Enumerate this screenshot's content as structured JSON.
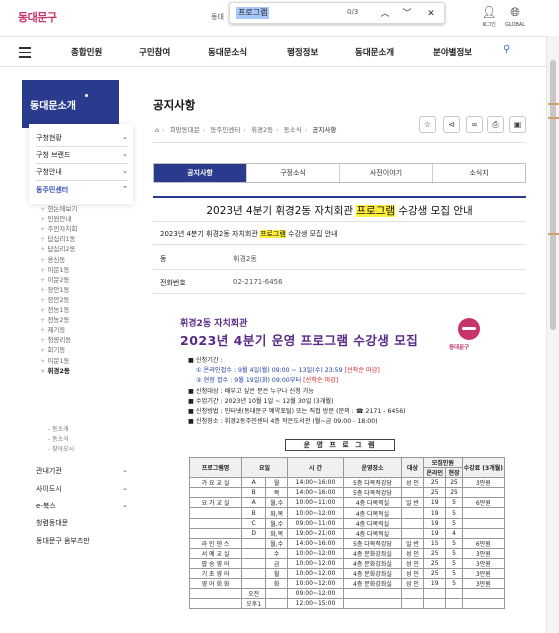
{
  "header": {
    "logo": "동대문구",
    "top_crumb": "동대",
    "login_label": "로그인",
    "global_label": "GLOBAL"
  },
  "find": {
    "query": "프로그램",
    "count": "0/3",
    "prev_icon": "chevron-up-icon",
    "next_icon": "chevron-down-icon",
    "close_icon": "close-icon"
  },
  "nav": {
    "items": [
      "종합민원",
      "구민참여",
      "동대문소식",
      "행정정보",
      "동대문소개",
      "분야별정보"
    ]
  },
  "sidebar": {
    "title": "동대문소개",
    "l1": [
      "구청현황",
      "구청 브랜드",
      "구청안내",
      "동주민센터"
    ],
    "dongs": [
      "전농1동주민센터",
      "한논에보기",
      "민원안내",
      "주민자치회",
      "답십리1동",
      "답십리2동",
      "용신동",
      "이문1동",
      "이문2동",
      "장안1동",
      "장안2동",
      "전농1동",
      "전농2동",
      "제기동",
      "청량리동",
      "회기동",
      "이문1동",
      "휘경2동"
    ],
    "dong_list": [
      "현논에보기",
      "민원안내",
      "주민자치회",
      "답십리1동",
      "답십리2동",
      "용신동",
      "이문1동",
      "이문2동",
      "장안1동",
      "장안2동",
      "전농1동",
      "전농2동",
      "제기동",
      "청량리동",
      "회기동",
      "이문1동",
      "휘경2동"
    ],
    "sub": [
      "동소개",
      "동소식",
      "찾아오시"
    ],
    "bottom": [
      "관내기관",
      "사이도시",
      "e-북스",
      "청렴동대문",
      "동대문구 옴부즈만"
    ]
  },
  "page": {
    "title": "공지사항",
    "crumbs": [
      "희망동대문",
      "동주민센터",
      "휘경2동",
      "동소식",
      "공지사항"
    ],
    "tabs": [
      "공지사항",
      "구정소식",
      "사진이야기",
      "소식지"
    ],
    "post_title_pre": "2023년 4분기 휘경2동 자치회관",
    "post_title_hl": "프로그램",
    "post_title_post": "수강생 모집 안내",
    "post_sub_pre": "2023년 4분기 휘경2동 자치회관",
    "post_sub_hl": "프로그램",
    "post_sub_post": "수강생 모집 안내",
    "dept_key": "동",
    "dept_val": "휘경2동",
    "phone_key": "전화번호",
    "phone_val": "02-2171-6456"
  },
  "poster": {
    "sub": "휘경2동 자치회관",
    "title": "2023년 4분기 운영 프로그램 수강생 모집",
    "brand": "동대문구",
    "period_label": "■ 신청기간 :",
    "online": "① 온라인접수 : 9월  4일(월) 09:00 ~ 13일(수) 23:59",
    "online_note": "[선착순 마감]",
    "onsite": "② 현장 접수 : 9월 19일(화) 09:00부터",
    "onsite_note": "[선착순 마감]",
    "target": "■ 신청대상 : 배우고 싶은 분은 누구나 신청 가능",
    "term": "■ 수업기간 : 2023년 10월 1일 ~ 12월 30일 (3개월)",
    "method": "■ 신청방법 : 인터넷(동대문구 예약포털) 또는 직접 방문 (문의 : ☎ 2171 - 6456)",
    "place": "■ 신청장소 : 휘경2동주민센터 4층 작은도서관 (월~금 09:00 - 18:00)",
    "schedule_title": "운 영 프 로 그 램",
    "table_head": [
      "프로그램명",
      "요일",
      "시 간",
      "운영장소",
      "대상",
      "온라인",
      "현장",
      "수강료 (3개월)"
    ],
    "table_head_group": "모집인원",
    "rows": [
      [
        "가 요 교 실",
        "A",
        "월",
        "14:00~16:00",
        "5층 다목적강당",
        "성 인",
        "25",
        "25",
        "3만원"
      ],
      [
        "",
        "B",
        "목",
        "14:00~16:00",
        "5층 다목적강당",
        "",
        "25",
        "25",
        ""
      ],
      [
        "요 가 교 실",
        "A",
        "월,수",
        "10:00~11:00",
        "4층 다목적실",
        "일 반",
        "19",
        "5",
        "6만원"
      ],
      [
        "",
        "B",
        "화,목",
        "10:00~12:00",
        "4층 다목적실",
        "",
        "19",
        "5",
        ""
      ],
      [
        "",
        "C",
        "월,수",
        "09:00~11:00",
        "4층 다목적실",
        "",
        "19",
        "5",
        ""
      ],
      [
        "",
        "D",
        "화,목",
        "19:00~21:00",
        "4층 다목적실",
        "",
        "19",
        "4",
        ""
      ],
      [
        "라 인 댄 스",
        "",
        "월,수",
        "14:00~16:00",
        "5층 다목적강당",
        "일 반",
        "15",
        "5",
        "6만원"
      ],
      [
        "서 예 교 실",
        "",
        "수",
        "10:00~12:00",
        "4층 문화강좌실",
        "성 인",
        "25",
        "5",
        "3만원"
      ],
      [
        "팝 송 영 어",
        "",
        "금",
        "10:00~12:00",
        "4층 문화강좌실",
        "성 인",
        "25",
        "5",
        "3만원"
      ],
      [
        "기 초 영 어",
        "",
        "월",
        "10:00~12:00",
        "4층 문화강좌실",
        "성 인",
        "25",
        "5",
        "3만원"
      ],
      [
        "영 어 회 화",
        "",
        "화",
        "10:00~12:00",
        "4층 문화강좌실",
        "성 인",
        "19",
        "5",
        "3만원"
      ],
      [
        "",
        "오전",
        "",
        "09:00~12:00",
        "",
        "",
        "",
        "",
        ""
      ],
      [
        "",
        "오후1",
        "",
        "12:00~15:00",
        "",
        "",
        "",
        "",
        ""
      ]
    ]
  },
  "colors": {
    "brand_navy": "#2a3a8c",
    "brand_pink": "#c8346a",
    "highlight": "#ffee3b",
    "poster_purple": "#5a2a86",
    "note_red": "#d12828"
  }
}
